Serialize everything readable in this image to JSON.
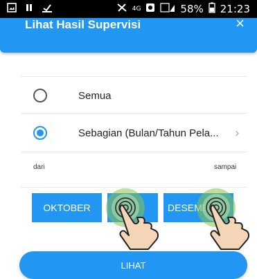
{
  "status_bar": {
    "network": "4G",
    "battery": "58%",
    "time": "21:23"
  },
  "app_bar": {
    "title": "Lihat Hasil Supervisi",
    "close_glyph": "×"
  },
  "options": [
    {
      "label": "Semua",
      "selected": false
    },
    {
      "label": "Sebagian (Bulan/Tahun Pela...",
      "selected": true,
      "chevron": "›"
    }
  ],
  "range": {
    "from_label": "dari",
    "to_label": "sampai",
    "from_month": "OKTOBER",
    "to_month": "DESEMBER"
  },
  "submit_label": "LIHAT",
  "colors": {
    "primary": "#2196f3",
    "tap_highlight": "#8bc34a"
  },
  "icons": [
    "image-icon",
    "pause-icon",
    "download-icon",
    "signal-icon",
    "battery-icon",
    "tap-gesture-icon"
  ]
}
